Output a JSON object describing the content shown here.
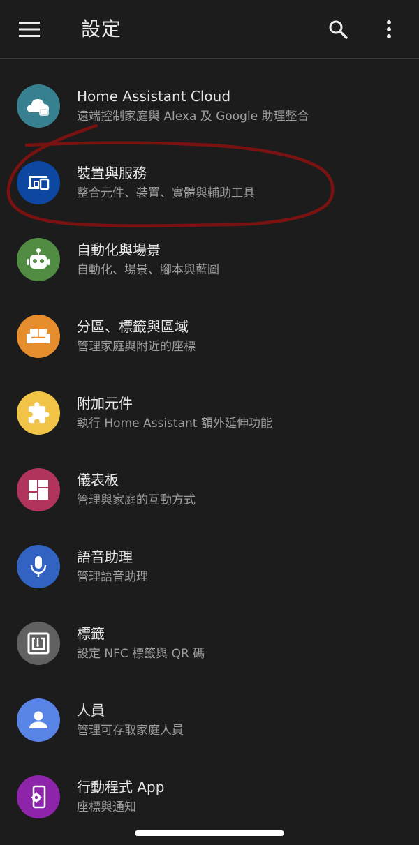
{
  "header": {
    "title": "設定"
  },
  "colors": {
    "background": "#1c1c1c",
    "annotation": "#7a1212"
  },
  "items": [
    {
      "label": "Home Assistant Cloud",
      "desc": "遠端控制家庭與 Alexa 及 Google 助理整合",
      "icon": "cloud-lock-icon",
      "color": "#37808f"
    },
    {
      "label": "裝置與服務",
      "desc": "整合元件、裝置、實體與輔助工具",
      "icon": "devices-icon",
      "color": "#0d47a1"
    },
    {
      "label": "自動化與場景",
      "desc": "自動化、場景、腳本與藍圖",
      "icon": "robot-icon",
      "color": "#518c43"
    },
    {
      "label": "分區、標籤與區域",
      "desc": "管理家庭與附近的座標",
      "icon": "sofa-icon",
      "color": "#e68d2e"
    },
    {
      "label": "附加元件",
      "desc": "執行 Home Assistant 額外延伸功能",
      "icon": "puzzle-icon",
      "color": "#f1c447"
    },
    {
      "label": "儀表板",
      "desc": "管理與家庭的互動方式",
      "icon": "dashboard-icon",
      "color": "#b1345c"
    },
    {
      "label": "語音助理",
      "desc": "管理語音助理",
      "icon": "microphone-icon",
      "color": "#3263c3"
    },
    {
      "label": "標籤",
      "desc": "設定 NFC 標籤與 QR 碼",
      "icon": "nfc-tag-icon",
      "color": "#616161"
    },
    {
      "label": "人員",
      "desc": "管理可存取家庭人員",
      "icon": "person-icon",
      "color": "#5884e5"
    },
    {
      "label": "行動程式 App",
      "desc": "座標與通知",
      "icon": "cellphone-cog-icon",
      "color": "#8e24aa"
    }
  ]
}
